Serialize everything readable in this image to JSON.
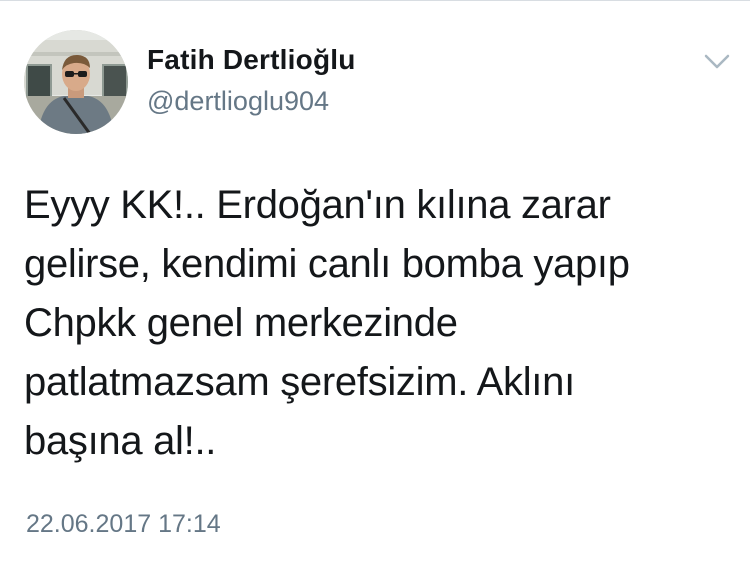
{
  "tweet": {
    "author": {
      "display_name": "Fatih Dertlioğlu",
      "handle": "@dertlioglu904"
    },
    "text": "Eyyy KK!.. Erdoğan'ın kılına zarar\ngelirse, kendimi canlı bomba yapıp\nChpkk genel merkezinde\npatlatmazsam şerefsizim. Aklını\nbaşına al!..",
    "timestamp": "22.06.2017 17:14",
    "menu_icon": "chevron-down-icon",
    "colors": {
      "name": "#14171a",
      "secondary": "#657786",
      "chevron": "#aab8c2",
      "divider": "#d8dde2"
    }
  }
}
